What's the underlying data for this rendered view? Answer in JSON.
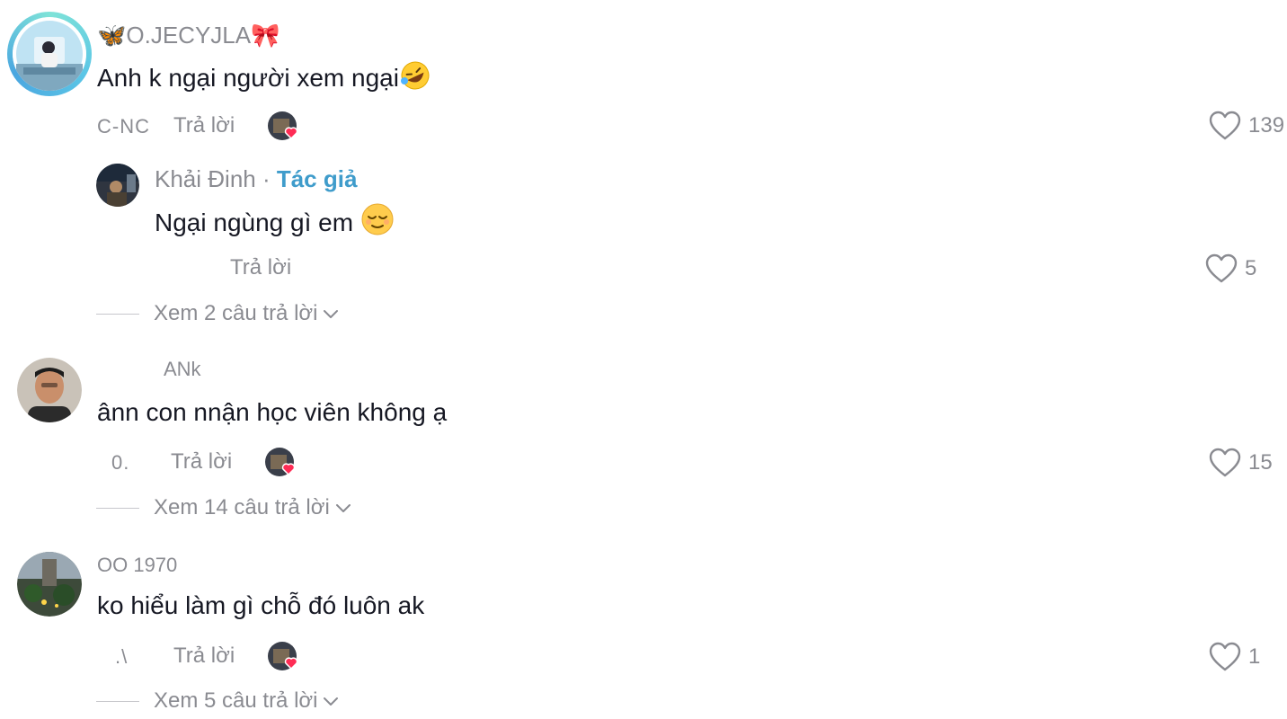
{
  "comments": [
    {
      "username": "🦋O.JECYJLA🎀",
      "text": "Anh k ngại người xem ngại",
      "emoji": "rofl-emoji",
      "date": "C-NC",
      "reply_label": "Trả lời",
      "likes": "139",
      "reply": {
        "username": "Khải Đinh",
        "separator": " · ",
        "author_label": "Tác giả",
        "text": "Ngại ngùng gì em",
        "emoji": "relieved-emoji",
        "reply_label": "Trả lời",
        "likes": "5"
      },
      "view_replies": "Xem 2 câu trả lời"
    },
    {
      "username": "ANk",
      "text": "ânn con nnận học viên không ạ",
      "date": "0.",
      "reply_label": "Trả lời",
      "likes": "15",
      "view_replies": "Xem 14 câu trả lời"
    },
    {
      "username": "OO    1970",
      "text": "ko hiểu làm gì chỗ đó luôn ak",
      "date": ".\\",
      "reply_label": "Trả lời",
      "likes": "1",
      "view_replies": "Xem 5 câu trả lời"
    }
  ],
  "colors": {
    "text": "#161823",
    "muted": "#8a8b91",
    "author": "#3f9ccb",
    "heart_badge": "#fe2c55"
  },
  "icons": {
    "like": "heart-outline-icon",
    "expand": "chevron-down-icon",
    "creator_liked": "creator-liked-heart-icon"
  }
}
